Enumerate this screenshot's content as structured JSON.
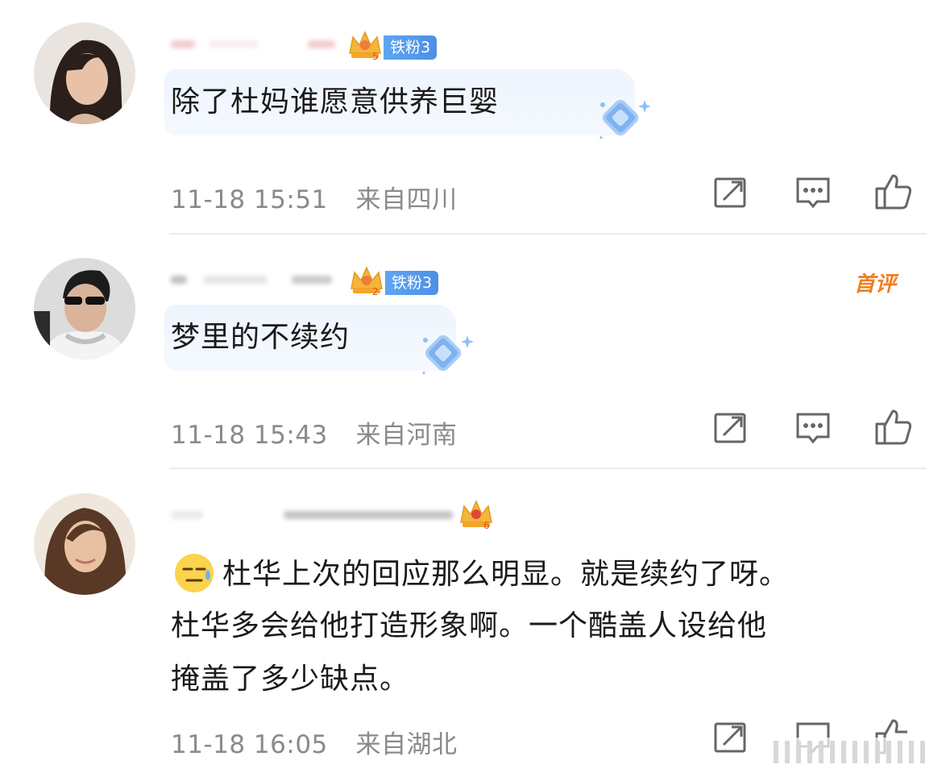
{
  "comments": [
    {
      "fan_level": "5",
      "fan_badge": "铁粉3",
      "text": "除了杜妈谁愿意供养巨婴",
      "time": "11-18 15:51",
      "location": "来自四川",
      "is_top": false
    },
    {
      "fan_level": "2",
      "fan_badge": "铁粉3",
      "text": "梦里的不续约",
      "time": "11-18 15:43",
      "location": "来自河南",
      "is_top": true,
      "top_tag": "首评"
    },
    {
      "fan_level": "6",
      "text_lines": [
        "杜华上次的回应那么明显。就是续约了呀。",
        "杜华多会给他打造形象啊。一个酷盖人设给他",
        "掩盖了多少缺点。"
      ],
      "time": "11-18 16:05",
      "location": "来自湖北",
      "is_top": false
    }
  ],
  "icons": {
    "repost": "repost-icon",
    "comment": "comment-icon",
    "like": "thumbs-up-icon",
    "crown": "crown-icon",
    "gem": "diamond-gem-icon",
    "emoji": "sweat-smile-emoji-icon"
  },
  "colors": {
    "fan_badge": "#4d8fe6",
    "top_tag": "#f07f1d",
    "meta_text": "#8a8a8a",
    "bubble": "#eef5fe"
  }
}
